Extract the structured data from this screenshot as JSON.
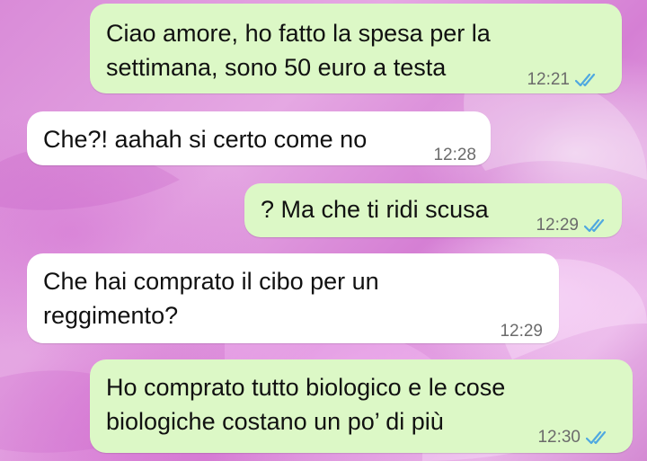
{
  "colors": {
    "outgoing_bubble": "#dcf8c6",
    "incoming_bubble": "#ffffff",
    "read_tick": "#4fa8e0",
    "wallpaper": "#d98bd8"
  },
  "messages": [
    {
      "direction": "outgoing",
      "lines": [
        "Ciao amore, ho fatto la spesa per la",
        "settimana, sono 50 euro a testa"
      ],
      "time": "12:21",
      "status_icon": "double-check-read-icon"
    },
    {
      "direction": "incoming",
      "lines": [
        "Che?! aahah si certo come no"
      ],
      "time": "12:28"
    },
    {
      "direction": "outgoing",
      "lines": [
        "? Ma che ti ridi scusa"
      ],
      "time": "12:29",
      "status_icon": "double-check-read-icon"
    },
    {
      "direction": "incoming",
      "lines": [
        "Che hai comprato il cibo per un",
        "reggimento?"
      ],
      "time": "12:29"
    },
    {
      "direction": "outgoing",
      "lines": [
        "Ho comprato tutto biologico e le cose",
        "biologiche costano un po’ di più"
      ],
      "time": "12:30",
      "status_icon": "double-check-read-icon"
    }
  ]
}
